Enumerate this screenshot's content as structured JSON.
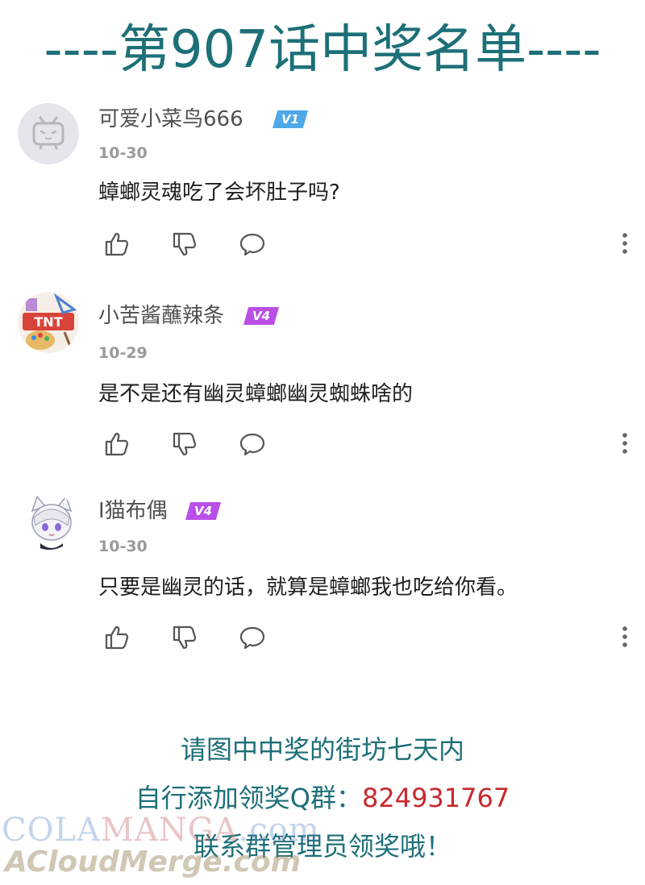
{
  "header": {
    "title": "----第907话中奖名单----"
  },
  "comments": [
    {
      "username": "可爱小菜鸟666",
      "vip_badge": "V1",
      "date": "10-30",
      "text": "蟑螂灵魂吃了会坏肚子吗?",
      "avatar_icon": "default-tv-avatar-icon"
    },
    {
      "username": "小苦酱蘸辣条",
      "vip_badge": "V4",
      "date": "10-29",
      "text": "是不是还有幽灵蟑螂幽灵蜘蛛啥的",
      "avatar_icon": "tnt-art-palette-avatar-icon"
    },
    {
      "username": "I猫布偶",
      "vip_badge": "V4",
      "date": "10-30",
      "text": "只要是幽灵的话，就算是蟑螂我也吃给你看。",
      "avatar_icon": "white-haired-cat-ear-avatar-icon"
    }
  ],
  "footer": {
    "line1": "请图中中奖的街坊七天内",
    "line2_prefix": "自行添加领奖Q群：",
    "line2_qq": "824931767",
    "line3": "联系群管理员领奖哦！"
  },
  "watermark": {
    "site_part1": "COLA",
    "site_part2": "MANGA",
    "site_part3": ".com",
    "secondary": "ACloudMerge.com"
  },
  "colors": {
    "accent_teal": "#1d6f78",
    "qq_red": "#c8282d",
    "vip_v1": "#4fa8e8",
    "vip_v4": "#b94fe6"
  }
}
